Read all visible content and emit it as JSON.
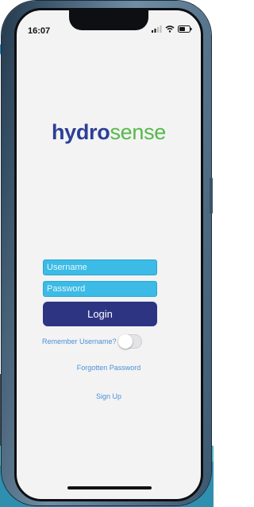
{
  "status_bar": {
    "time": "16:07"
  },
  "brand": {
    "part1": "hydro",
    "part2": "sense"
  },
  "login_form": {
    "username_placeholder": "Username",
    "password_placeholder": "Password",
    "login_label": "Login",
    "remember_label": "Remember Username?",
    "remember_on": false
  },
  "links": {
    "forgotten_password": "Forgotten Password",
    "sign_up": "Sign Up"
  },
  "colors": {
    "brand_blue": "#2d3f96",
    "brand_green": "#56b948",
    "field_bg": "#3bbbe6",
    "button_bg": "#2d3583",
    "link": "#4a90d6"
  },
  "icons": [
    "signal-icon",
    "wifi-icon",
    "battery-icon"
  ]
}
